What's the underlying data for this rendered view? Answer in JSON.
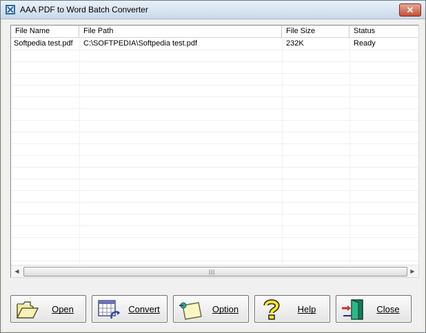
{
  "window": {
    "title": "AAA PDF to Word Batch Converter",
    "close_glyph": "✕"
  },
  "list": {
    "columns": [
      "File Name",
      "File Path",
      "File Size",
      "Status"
    ],
    "rows": [
      {
        "name": "Softpedia test.pdf",
        "path": "C:\\SOFTPEDIA\\Softpedia test.pdf",
        "size": "232K",
        "status": "Ready"
      }
    ]
  },
  "scrollbar": {
    "left_arrow": "◀",
    "right_arrow": "▶",
    "grip": "|||"
  },
  "buttons": {
    "open": {
      "label": "Open",
      "icon": "folder-open-icon"
    },
    "convert": {
      "label": "Convert",
      "icon": "calendar-refresh-icon"
    },
    "option": {
      "label": "Option",
      "icon": "note-pin-icon"
    },
    "help": {
      "label": "Help",
      "icon": "question-mark-icon"
    },
    "close": {
      "label": "Close",
      "icon": "exit-door-icon"
    }
  }
}
